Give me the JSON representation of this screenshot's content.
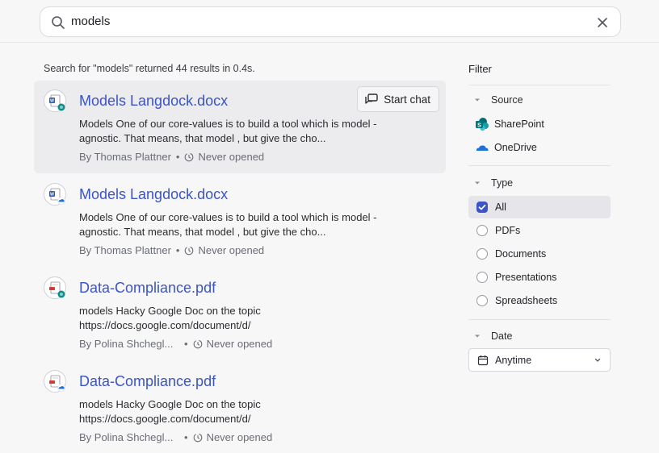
{
  "search": {
    "query": "models"
  },
  "summary": "Search for \"models\" returned 44 results in 0.4s.",
  "results": [
    {
      "title": "Models Langdock.docx",
      "snippet": "Models One of our core-values is to build a tool which is model - agnostic. That means, that model , but give the cho...",
      "author": "By Thomas Plattner",
      "opened": "Never opened",
      "file_type": "word",
      "source": "sharepoint",
      "action": "Start chat"
    },
    {
      "title": "Models Langdock.docx",
      "snippet": "Models One of our core-values is to build a tool which is model - agnostic. That means, that model , but give the cho...",
      "author": "By Thomas Plattner",
      "opened": "Never opened",
      "file_type": "word",
      "source": "onedrive"
    },
    {
      "title": "Data-Compliance.pdf",
      "snippet": "models Hacky Google Doc on the topic https://docs.google.com/document/d/",
      "author": "By Polina Shchegl...",
      "opened": "Never opened",
      "file_type": "pdf",
      "source": "sharepoint"
    },
    {
      "title": "Data-Compliance.pdf",
      "snippet": "models Hacky Google Doc on the topic https://docs.google.com/document/d/",
      "author": "By Polina Shchegl...",
      "opened": "Never opened",
      "file_type": "pdf",
      "source": "onedrive"
    }
  ],
  "filter": {
    "heading": "Filter",
    "source": {
      "label": "Source",
      "items": [
        "SharePoint",
        "OneDrive"
      ]
    },
    "type": {
      "label": "Type",
      "items": [
        {
          "label": "All",
          "checked": true
        },
        {
          "label": "PDFs",
          "checked": false
        },
        {
          "label": "Documents",
          "checked": false
        },
        {
          "label": "Presentations",
          "checked": false
        },
        {
          "label": "Spreadsheets",
          "checked": false
        }
      ]
    },
    "date": {
      "label": "Date",
      "selected": "Anytime"
    }
  },
  "colors": {
    "accent": "#3b54c6",
    "link": "#3b54c6",
    "sharepoint": "#138a8a",
    "onedrive": "#1e73d8"
  },
  "icons": {
    "search": "search-icon",
    "clear": "close-icon",
    "chat": "chat-bubble-icon",
    "clock": "clock-icon",
    "caret": "caret-down-icon",
    "calendar": "calendar-icon",
    "chevron": "chevron-down-icon"
  }
}
